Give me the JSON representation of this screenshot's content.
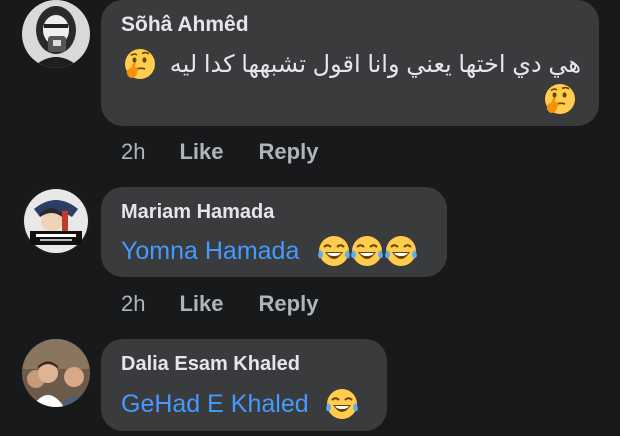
{
  "colors": {
    "background": "#18191a",
    "bubble": "#3a3b3c",
    "text": "#e4e6eb",
    "secondary": "#b0b3b8",
    "mention": "#4599ff"
  },
  "comments": [
    {
      "author": "Sõhâ Ahmêd",
      "text": "هي دي اختها يعني وانا اقول تشبهها كدا ليه",
      "emojis": [
        "thinking-face-icon",
        "thinking-face-icon"
      ],
      "time": "2h",
      "like_label": "Like",
      "reply_label": "Reply"
    },
    {
      "author": "Mariam Hamada",
      "mention": "Yomna Hamada",
      "emojis": [
        "tears-of-joy-icon",
        "tears-of-joy-icon",
        "tears-of-joy-icon"
      ],
      "time": "2h",
      "like_label": "Like",
      "reply_label": "Reply"
    },
    {
      "author": "Dalia Esam Khaled",
      "mention": "GeHad E Khaled",
      "emojis": [
        "tears-of-joy-icon"
      ]
    }
  ]
}
